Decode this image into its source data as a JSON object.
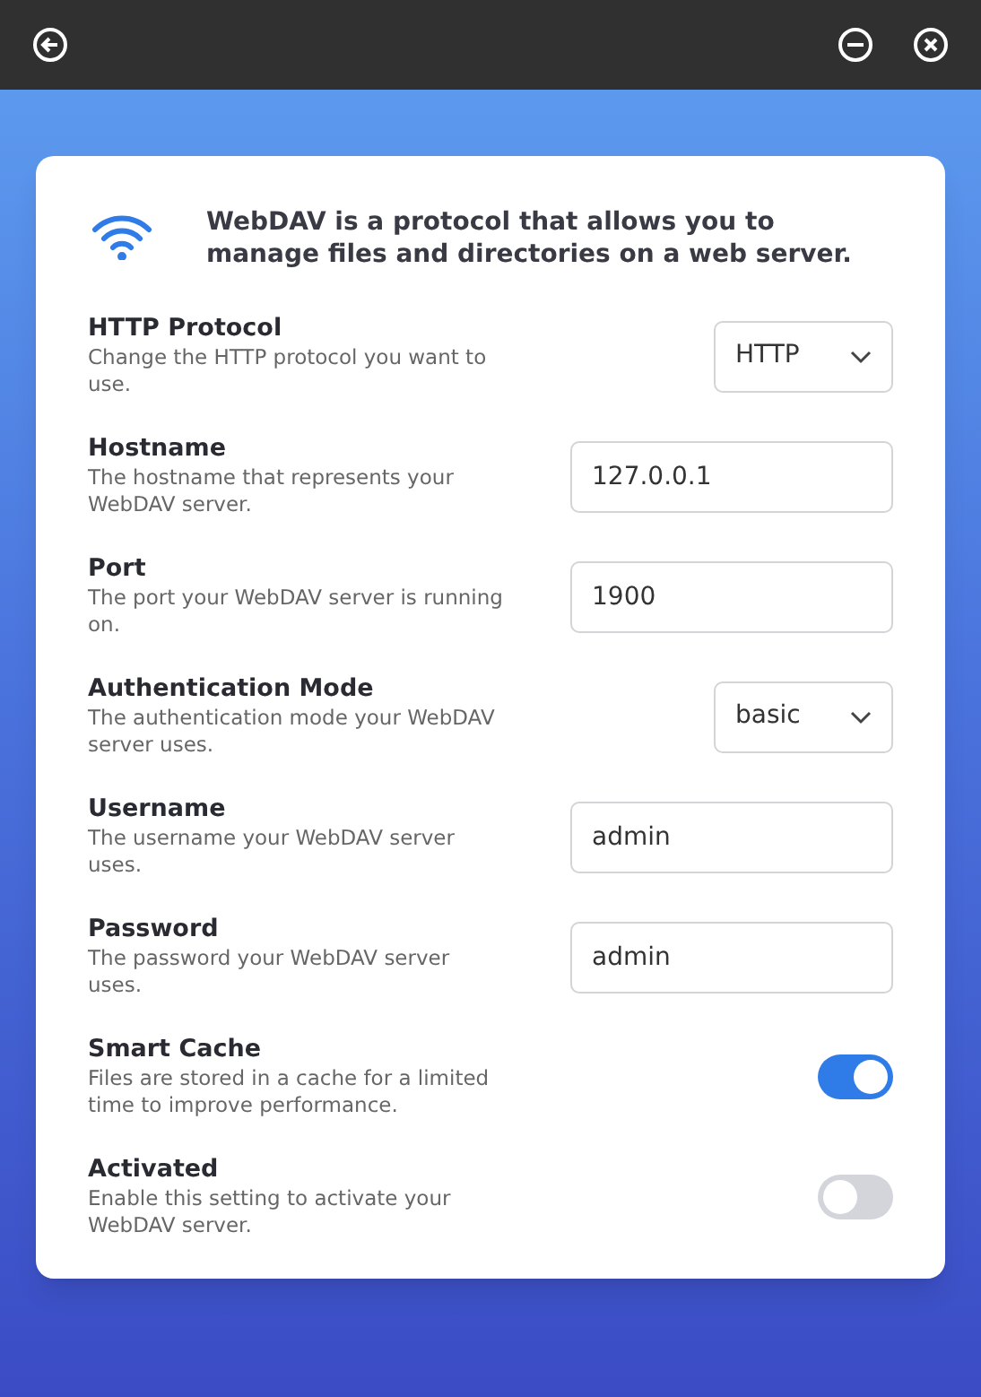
{
  "intro": "WebDAV is a protocol that allows you to manage files and directories on a web server.",
  "settings": [
    {
      "label": "HTTP Protocol",
      "description": "Change the HTTP protocol you want to use.",
      "kind": "select",
      "value": "HTTP"
    },
    {
      "label": "Hostname",
      "description": "The hostname that represents your WebDAV server.",
      "kind": "input",
      "value": "127.0.0.1"
    },
    {
      "label": "Port",
      "description": "The port your WebDAV server is running on.",
      "kind": "input",
      "value": "1900"
    },
    {
      "label": "Authentication Mode",
      "description": "The authentication mode your WebDAV server uses.",
      "kind": "select",
      "value": "basic"
    },
    {
      "label": "Username",
      "description": "The username your WebDAV server uses.",
      "kind": "input",
      "value": "admin"
    },
    {
      "label": "Password",
      "description": "The password your WebDAV server uses.",
      "kind": "input",
      "value": "admin"
    },
    {
      "label": "Smart Cache",
      "description": "Files are stored in a cache for a limited time to improve performance.",
      "kind": "toggle",
      "on": true
    },
    {
      "label": "Activated",
      "description": "Enable this setting to activate your WebDAV server.",
      "kind": "toggle",
      "on": false
    }
  ]
}
